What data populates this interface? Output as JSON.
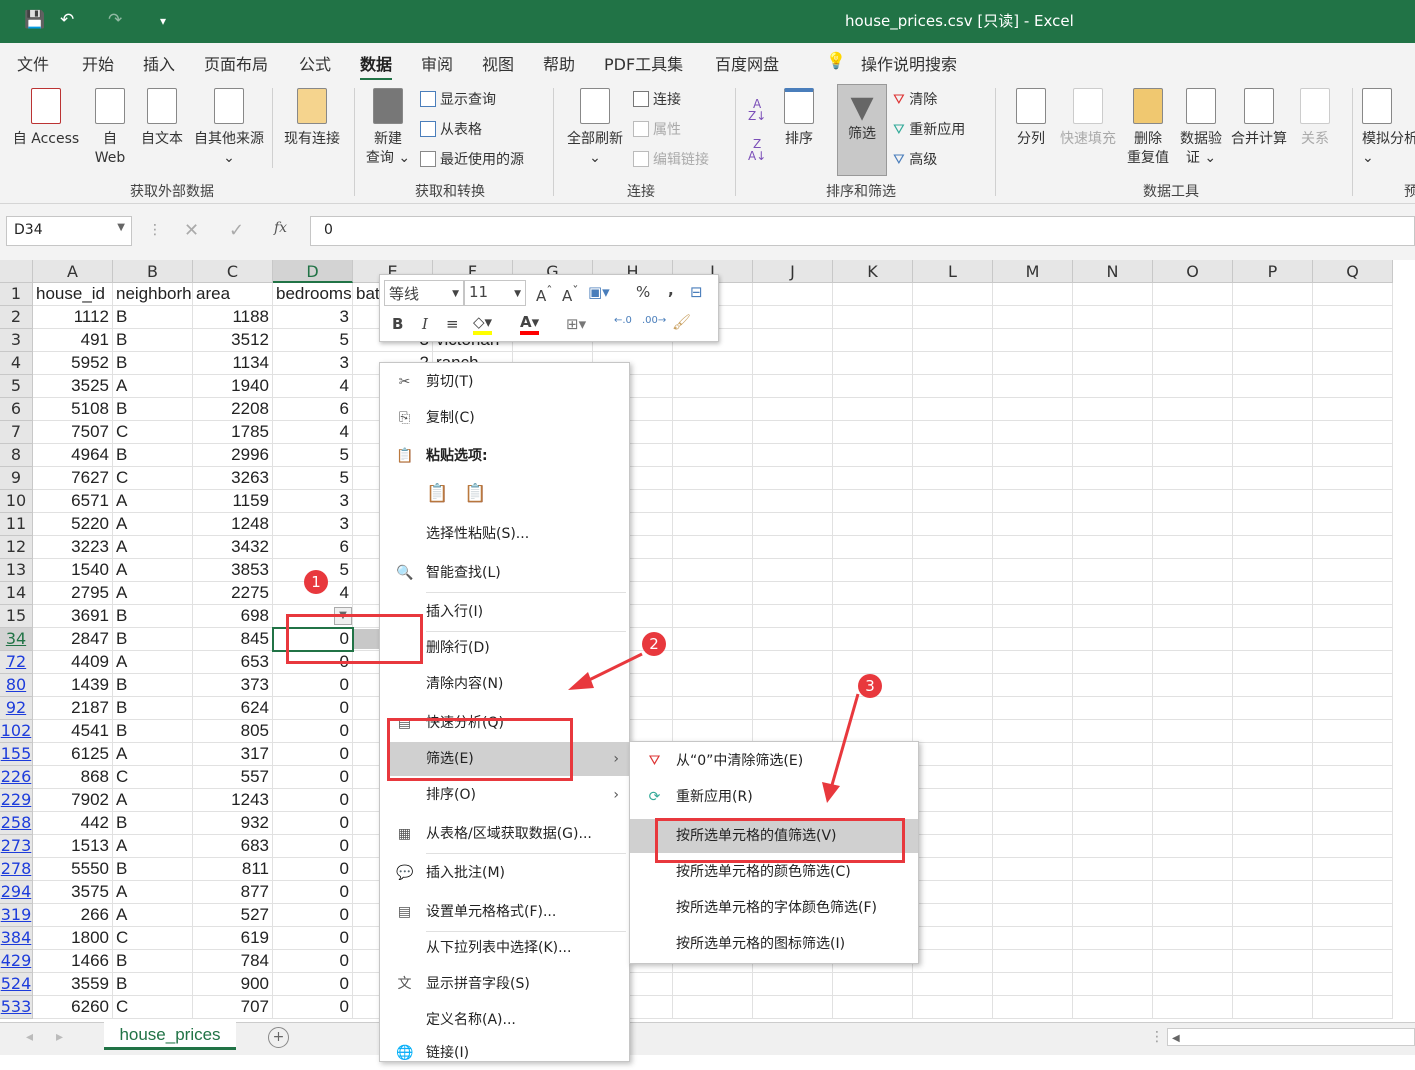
{
  "window": {
    "title": "house_prices.csv  [只读]  -  Excel",
    "qa_save": "💾",
    "qa_undo": "↶",
    "qa_redo": "↷",
    "qa_more": "▾"
  },
  "menu_tabs": [
    "文件",
    "开始",
    "插入",
    "页面布局",
    "公式",
    "数据",
    "审阅",
    "视图",
    "帮助",
    "PDF工具集",
    "百度网盘",
    "操作说明搜索"
  ],
  "ribbon": {
    "groups": [
      "获取外部数据",
      "获取和转换",
      "连接",
      "排序和筛选",
      "数据工具",
      "预"
    ],
    "ext": [
      "自 Access",
      "自\nWeb",
      "自文本",
      "自其他来源",
      "现有连接"
    ],
    "transform": {
      "new_query": "新建\n查询 ⌄",
      "show_query": "显示查询",
      "from_table": "从表格",
      "recent": "最近使用的源"
    },
    "conn": {
      "refresh_all": "全部刷新",
      "connections": "连接",
      "properties": "属性",
      "edit_links": "编辑链接"
    },
    "sort": {
      "sort": "排序",
      "filter": "筛选",
      "clear": "清除",
      "reapply": "重新应用",
      "advanced": "高级"
    },
    "tools": [
      "分列",
      "快速填充",
      "删除\n重复值",
      "数据验\n证 ⌄",
      "合并计算",
      "关系",
      "模拟分析\n⌄"
    ]
  },
  "formula": {
    "name_box": "D34",
    "value": "0",
    "fx": "fx"
  },
  "columns": [
    "A",
    "B",
    "C",
    "D",
    "E",
    "F",
    "G",
    "H",
    "I",
    "J",
    "K",
    "L",
    "M",
    "N",
    "O",
    "P",
    "Q"
  ],
  "selected_column": "D",
  "headers": [
    "house_id",
    "neighborhood",
    "area",
    "bedrooms",
    "bathrooms"
  ],
  "rows": [
    {
      "n": "1",
      "f": false,
      "v": [
        "house_id",
        "neighborhood",
        "area",
        "bedrooms",
        "bat"
      ]
    },
    {
      "n": "2",
      "f": false,
      "v": [
        "1112",
        "B",
        "1188",
        "3"
      ]
    },
    {
      "n": "3",
      "f": false,
      "v": [
        "491",
        "B",
        "3512",
        "5",
        "3",
        "victorian"
      ]
    },
    {
      "n": "4",
      "f": false,
      "v": [
        "5952",
        "B",
        "1134",
        "3",
        "2",
        "ranch"
      ]
    },
    {
      "n": "5",
      "f": false,
      "v": [
        "3525",
        "A",
        "1940",
        "4"
      ]
    },
    {
      "n": "6",
      "f": false,
      "v": [
        "5108",
        "B",
        "2208",
        "6"
      ]
    },
    {
      "n": "7",
      "f": false,
      "v": [
        "7507",
        "C",
        "1785",
        "4"
      ]
    },
    {
      "n": "8",
      "f": false,
      "v": [
        "4964",
        "B",
        "2996",
        "5"
      ]
    },
    {
      "n": "9",
      "f": false,
      "v": [
        "7627",
        "C",
        "3263",
        "5"
      ]
    },
    {
      "n": "10",
      "f": false,
      "v": [
        "6571",
        "A",
        "1159",
        "3"
      ]
    },
    {
      "n": "11",
      "f": false,
      "v": [
        "5220",
        "A",
        "1248",
        "3"
      ]
    },
    {
      "n": "12",
      "f": false,
      "v": [
        "3223",
        "A",
        "3432",
        "6"
      ]
    },
    {
      "n": "13",
      "f": false,
      "v": [
        "1540",
        "A",
        "3853",
        "5"
      ]
    },
    {
      "n": "14",
      "f": false,
      "v": [
        "2795",
        "A",
        "2275",
        "4"
      ]
    },
    {
      "n": "15",
      "f": false,
      "v": [
        "3691",
        "B",
        "698",
        ""
      ]
    },
    {
      "n": "34",
      "f": true,
      "v": [
        "2847",
        "B",
        "845",
        "0"
      ]
    },
    {
      "n": "72",
      "f": true,
      "v": [
        "4409",
        "A",
        "653",
        "0"
      ]
    },
    {
      "n": "80",
      "f": true,
      "v": [
        "1439",
        "B",
        "373",
        "0"
      ]
    },
    {
      "n": "92",
      "f": true,
      "v": [
        "2187",
        "B",
        "624",
        "0"
      ]
    },
    {
      "n": "102",
      "f": true,
      "v": [
        "4541",
        "B",
        "805",
        "0"
      ]
    },
    {
      "n": "155",
      "f": true,
      "v": [
        "6125",
        "A",
        "317",
        "0"
      ]
    },
    {
      "n": "226",
      "f": true,
      "v": [
        "868",
        "C",
        "557",
        "0"
      ]
    },
    {
      "n": "229",
      "f": true,
      "v": [
        "7902",
        "A",
        "1243",
        "0"
      ]
    },
    {
      "n": "258",
      "f": true,
      "v": [
        "442",
        "B",
        "932",
        "0"
      ]
    },
    {
      "n": "273",
      "f": true,
      "v": [
        "1513",
        "A",
        "683",
        "0"
      ]
    },
    {
      "n": "278",
      "f": true,
      "v": [
        "5550",
        "B",
        "811",
        "0"
      ]
    },
    {
      "n": "294",
      "f": true,
      "v": [
        "3575",
        "A",
        "877",
        "0"
      ]
    },
    {
      "n": "319",
      "f": true,
      "v": [
        "266",
        "A",
        "527",
        "0"
      ]
    },
    {
      "n": "384",
      "f": true,
      "v": [
        "1800",
        "C",
        "619",
        "0"
      ]
    },
    {
      "n": "429",
      "f": true,
      "v": [
        "1466",
        "B",
        "784",
        "0"
      ]
    },
    {
      "n": "524",
      "f": true,
      "v": [
        "3559",
        "B",
        "900",
        "0"
      ]
    },
    {
      "n": "533",
      "f": true,
      "v": [
        "6260",
        "C",
        "707",
        "0"
      ]
    }
  ],
  "mini_toolbar": {
    "font": "等线",
    "size": "11",
    "bold": "B",
    "italic": "I",
    "percent": "%",
    "comma": ","
  },
  "context_menu": [
    {
      "label": "剪切(T)",
      "icon": "✂"
    },
    {
      "label": "复制(C)",
      "icon": "⎘"
    },
    {
      "label": "粘贴选项:",
      "icon": "📋",
      "bold": true
    },
    {
      "label": "",
      "icon": ""
    },
    {
      "label": "选择性粘贴(S)...",
      "icon": ""
    },
    {
      "label": "智能查找(L)",
      "icon": "🔍"
    },
    {
      "label": "插入行(I)",
      "icon": ""
    },
    {
      "label": "删除行(D)",
      "icon": ""
    },
    {
      "label": "清除内容(N)",
      "icon": ""
    },
    {
      "label": "快速分析(Q)",
      "icon": "▤"
    },
    {
      "label": "筛选(E)",
      "icon": "",
      "sub": true,
      "hl": true
    },
    {
      "label": "排序(O)",
      "icon": "",
      "sub": true
    },
    {
      "label": "从表格/区域获取数据(G)...",
      "icon": "▦"
    },
    {
      "label": "插入批注(M)",
      "icon": "💬"
    },
    {
      "label": "设置单元格格式(F)...",
      "icon": "▤"
    },
    {
      "label": "从下拉列表中选择(K)...",
      "icon": ""
    },
    {
      "label": "显示拼音字段(S)",
      "icon": "文"
    },
    {
      "label": "定义名称(A)...",
      "icon": ""
    },
    {
      "label": "链接(I)",
      "icon": "🌐"
    }
  ],
  "submenu": [
    {
      "label": "从“0”中清除筛选(E)",
      "icon": "⛛"
    },
    {
      "label": "重新应用(R)",
      "icon": "⟳"
    },
    {
      "label": "按所选单元格的值筛选(V)",
      "icon": "",
      "hl": true
    },
    {
      "label": "按所选单元格的颜色筛选(C)",
      "icon": ""
    },
    {
      "label": "按所选单元格的字体颜色筛选(F)",
      "icon": ""
    },
    {
      "label": "按所选单元格的图标筛选(I)",
      "icon": ""
    }
  ],
  "annotations": [
    "1",
    "2",
    "3"
  ],
  "sheet_tabs": {
    "active": "house_prices",
    "add": "+"
  },
  "colors": {
    "excel_green": "#217346",
    "annotation_red": "#e8383d",
    "filtered_row_number": "#1d3cdb"
  }
}
